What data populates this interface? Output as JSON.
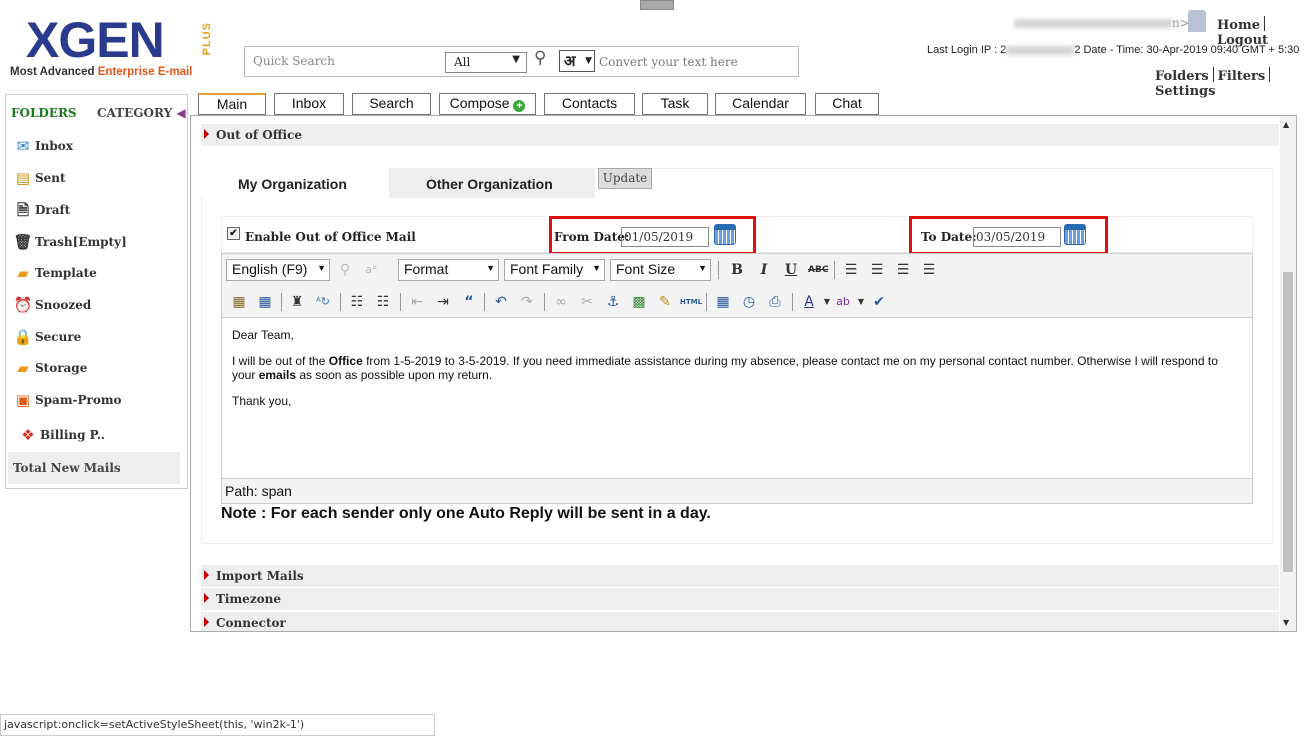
{
  "logo": {
    "brand": "XGEN",
    "plus": "PLUS",
    "tagline_a": "Most Advanced ",
    "tagline_b": "Enterprise E-mail"
  },
  "search": {
    "placeholder": "Quick Search",
    "scope": "All",
    "convert_placeholder": "Convert your text here",
    "lang_glyph": "अ"
  },
  "user": {
    "suffix": "n>",
    "home": "Home",
    "logout": "Logout"
  },
  "login": {
    "prefix": "Last Login IP : 2",
    "rest": "2 Date - Time: 30-Apr-2019 09:40 GMT + 5:30"
  },
  "tools": {
    "folders": "Folders",
    "filters": "Filters",
    "settings": "Settings"
  },
  "sidebar": {
    "folders": "FOLDERS",
    "category": "CATEGORY",
    "items": [
      {
        "label": "Inbox",
        "icon": "inbox-icon"
      },
      {
        "label": "Sent",
        "icon": "sent-icon"
      },
      {
        "label": "Draft",
        "icon": "draft-icon"
      },
      {
        "label": "Trash[Empty]",
        "icon": "trash-icon"
      },
      {
        "label": "Template",
        "icon": "folder-icon"
      },
      {
        "label": "Snoozed",
        "icon": "alarm-clock-icon"
      },
      {
        "label": "Secure",
        "icon": "lock-icon"
      },
      {
        "label": "Storage",
        "icon": "storage-folder-icon"
      },
      {
        "label": "Spam-Promo",
        "icon": "spam-icon"
      },
      {
        "label": "Billing P..",
        "icon": "billing-icon"
      }
    ],
    "total_new": "Total New Mails"
  },
  "tabs": [
    "Main",
    "Inbox",
    "Search",
    "Compose",
    "Contacts",
    "Task",
    "Calendar",
    "Chat"
  ],
  "sections": {
    "out_of_office": "Out of Office",
    "import": "Import Mails",
    "timezone": "Timezone",
    "connector": "Connector"
  },
  "ooo": {
    "tab_my": "My Organization",
    "tab_other": "Other Organization",
    "update": "Update",
    "enable_label": "Enable Out of Office Mail",
    "enabled": true,
    "from_label": "From Date:",
    "from_value": "01/05/2019",
    "to_label": "To Date:",
    "to_value": "03/05/2019",
    "note": "Note : For each sender only one Auto Reply will be sent in a day."
  },
  "editor": {
    "lang": "English (F9)",
    "format": "Format",
    "font_family": "Font Family",
    "font_size": "Font Size",
    "greeting": "Dear Team,",
    "body_a": "I will be out of the ",
    "body_b": "Office",
    "body_c": " from 1-5-2019 to 3-5-2019. If you need immediate assistance during my absence, please contact me on my personal contact number. Otherwise I will respond to your ",
    "body_d": "emails",
    "body_e": " as soon as possible upon my return.",
    "closing": "Thank you,",
    "path": "Path: span"
  },
  "status": "javascript:onclick=setActiveStyleSheet(this, 'win2k-1')"
}
